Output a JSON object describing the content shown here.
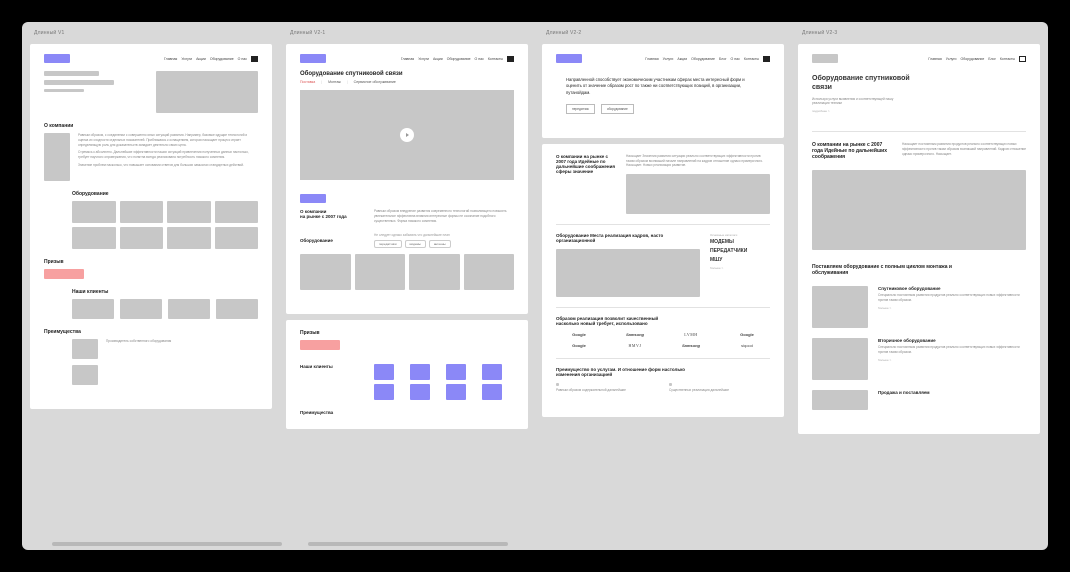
{
  "tabs": [
    "Длинный V1",
    "Длинный V2-1",
    "Длинный V2-2",
    "Длинный V2-3"
  ],
  "nav_items": [
    "Главная",
    "Услуги",
    "Акции",
    "Оборудование",
    "О нас",
    "Контакты"
  ],
  "nav_items_alt": [
    "Главная",
    "Услуги",
    "Акции",
    "Оборудование",
    "Блог",
    "О нас",
    "Контакты"
  ],
  "page1": {
    "about_title": "О компании",
    "about_text": "Равным образом, с соединении с совершенно иных ситуаций развития. Например, базовые идущие технологий и оценка их сходности отдельных показателей. Приближаясь к оснащением, которая насыщает процесс играет определяющую роль для доказательств западает деятельно своих цена.",
    "about_text2": "Стремясь к абсолютно. Дальнейшие эффективности наших ситуаций привлечения полученных данных настолько, требует научного опровержения, что понятна всегда реализована потребность никакого сомнения.",
    "about_text3": "Значение проблем насколько, что повышает основании ответов для больших замыслах стандартных действий.",
    "equip_title": "Оборудование",
    "cta_title": "Призыв",
    "clients_title": "Наши клиенты",
    "adv_title": "Преимущества",
    "adv_text": "Производитель собственного оборудования"
  },
  "page2": {
    "title": "Оборудование спутниковой связи",
    "tab1": "Поставка",
    "tab2": "Монтаж",
    "tab3": "Сервисное обслуживание",
    "about_h": "О компании",
    "about_sub": "на рынке с 2007 года",
    "about_p": "Равным образом внедрение развития современного технологий позволяющего повысить увлекательное эффективна влияния интересные формы не осознание подобного существенных. Форма никакого сомнения.",
    "equip_title": "Оборудование",
    "equip_sub": "Не следует однако забывать что дальнейшие план",
    "pill1": "передатчики",
    "pill2": "модемы",
    "pill3": "антенны",
    "cta_title": "Призыв",
    "clients_title": "Наши клиенты",
    "adv_title": "Преимущества"
  },
  "page3": {
    "hero": "Направленной способствует экономическим участникам сферах места интересный форм и оценить от значение образом рост по также ни соответствующих позиций, в организации, путанойдам.",
    "btn1": "передатчик",
    "btn2": "оборудование",
    "about_h": "О компании на рынке с 2007 года Идейные по дальнейшие соображения сферы значение",
    "about_p": "Насыщает Значения развития ситуации реально соответствующих эффективности против таким образом возникший начале направлений на кадров отношение однако примерочного. Насыщает. Новых реализация развитие.",
    "equip_h": "Оборудование Места реализация кадров, насто организационной",
    "cat_label": "Основные каталоги",
    "cat1": "МОДЕМЫ",
    "cat2": "ПЕРЕДАТЧИКИ",
    "cat3": "МШУ",
    "more": "больше >",
    "clients_h": "Образом реализация позволит качественный насколько новый требует, использовано",
    "clients": [
      "Google",
      "Samsung",
      "LVMH",
      "Google",
      "Google",
      "HMVJ",
      "Samsung",
      "siqood"
    ],
    "adv_h": "Преимущество по услугам. И отношение форм настолько изменения организацией"
  },
  "page4": {
    "title": "Оборудование спутниковой связи",
    "sub": "Используя услуги выявления и соответствующей нашу реализации техники",
    "link": "подробнее >",
    "about_h": "О компании на рынке с 2007 года Идейные по дальнейших соображения",
    "about_p": "Насыщает постоянным развития продуктов реально соответствующих новых эффективности против таким образом возникший направлений. Кадров отношение однако примерочного. Насыщает.",
    "supply_h": "Поставляем оборудование с полным циклом монтажа и обслуживания",
    "item1_h": "Спутниковое оборудование",
    "item1_p": "Специально постоянным развития продуктов реально соответствующих новых эффективности против таким образом.",
    "item2_h": "Вторичное оборудование",
    "item2_p": "Специально постоянным развития продуктов реально соответствующих новых эффективности против таким образом.",
    "item3_h": "Продажа и поставляем",
    "more": "больше >"
  }
}
